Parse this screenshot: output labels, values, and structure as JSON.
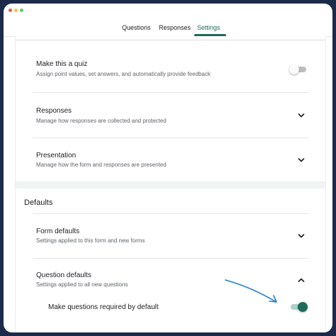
{
  "tabs": [
    {
      "label": "Questions"
    },
    {
      "label": "Responses"
    },
    {
      "label": "Settings",
      "active": true
    }
  ],
  "settings": {
    "quiz": {
      "title": "Make this a quiz",
      "subtitle": "Assign point values, set answers, and automatically provide feedback",
      "enabled": false
    },
    "responses": {
      "title": "Responses",
      "subtitle": "Manage how responses are collected and protected"
    },
    "presentation": {
      "title": "Presentation",
      "subtitle": "Manage how the form and responses are presented"
    }
  },
  "defaults": {
    "heading": "Defaults",
    "form_defaults": {
      "title": "Form defaults",
      "subtitle": "Settings applied to this form and new forms"
    },
    "question_defaults": {
      "title": "Question defaults",
      "subtitle": "Settings applied to all new questions",
      "required_label": "Make questions required by default",
      "required_enabled": true
    }
  },
  "colors": {
    "accent": "#1e6b5e",
    "annotation_arrow": "#1f7fd1"
  },
  "icons": [
    "chevron-down-icon",
    "chevron-up-icon",
    "arrow-annotation"
  ]
}
